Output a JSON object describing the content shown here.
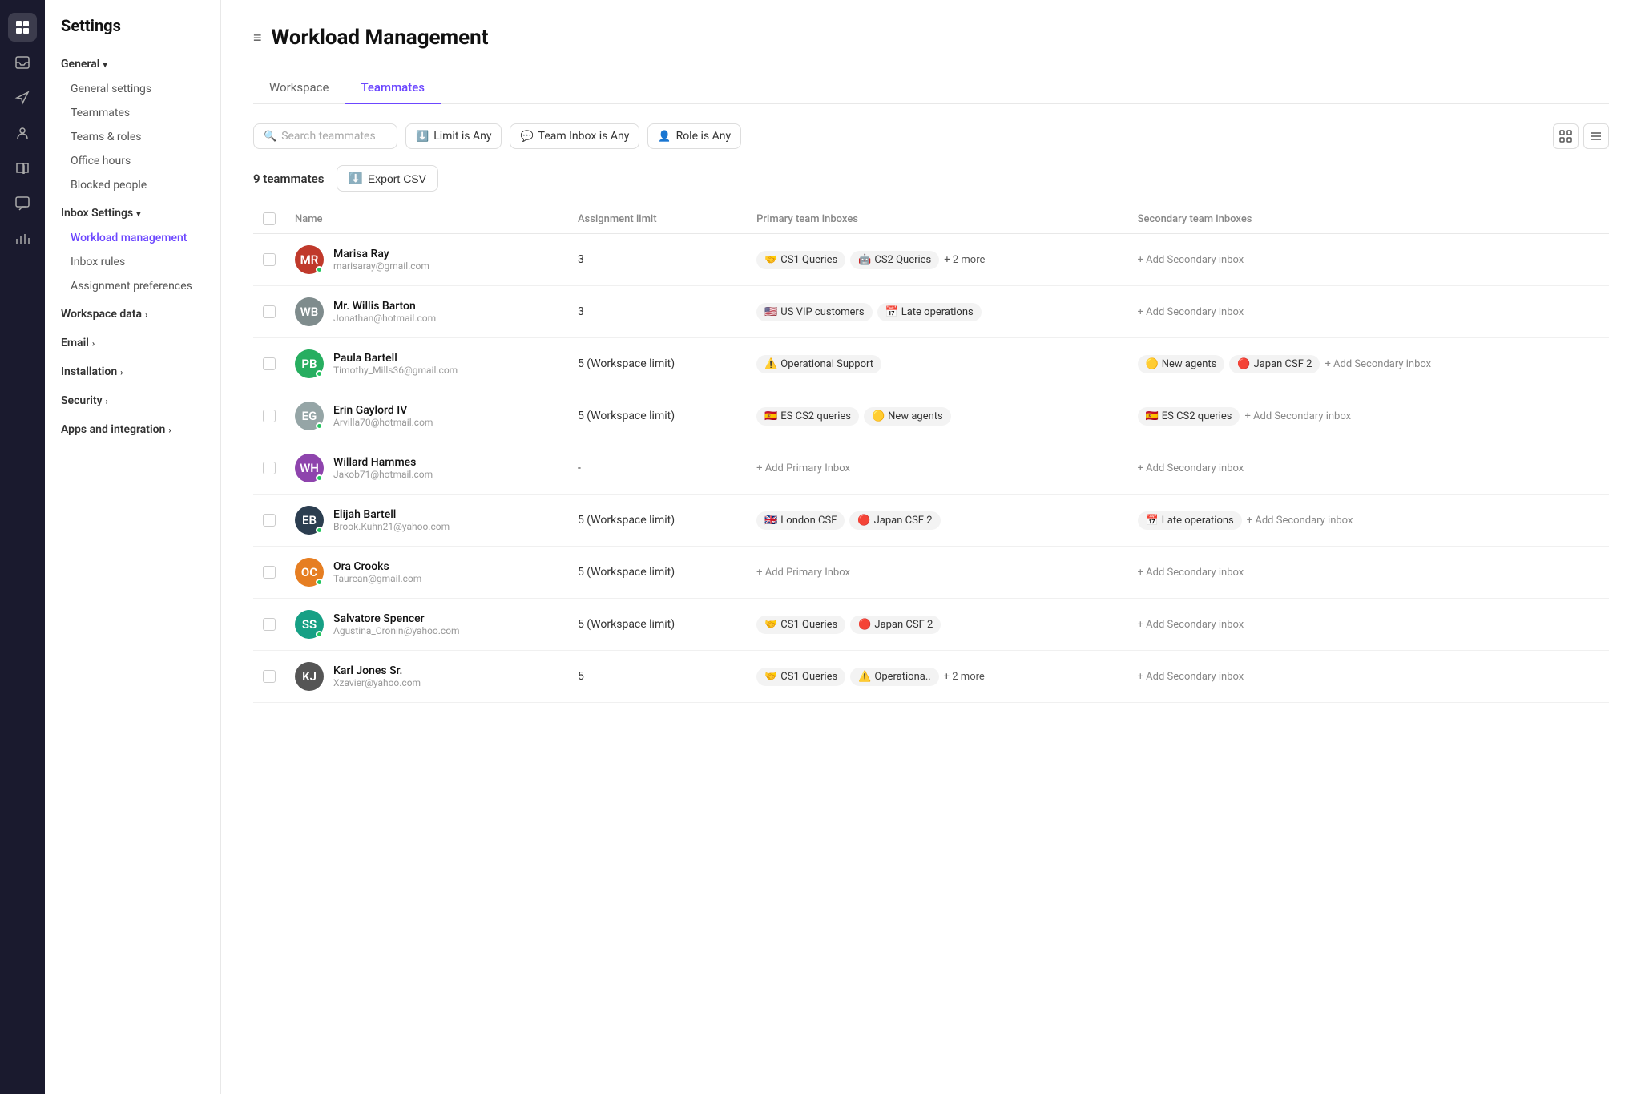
{
  "app": {
    "title": "Settings"
  },
  "sidebar": {
    "title": "Settings",
    "sections": [
      {
        "label": "General",
        "has_chevron": true,
        "items": [
          {
            "label": "General settings",
            "active": false
          },
          {
            "label": "Teammates",
            "active": false
          },
          {
            "label": "Teams & roles",
            "active": false
          },
          {
            "label": "Office hours",
            "active": false
          },
          {
            "label": "Blocked people",
            "active": false
          }
        ]
      },
      {
        "label": "Inbox Settings",
        "has_chevron": true,
        "items": [
          {
            "label": "Workload management",
            "active": true
          },
          {
            "label": "Inbox rules",
            "active": false
          },
          {
            "label": "Assignment preferences",
            "active": false
          }
        ]
      },
      {
        "label": "Workspace data",
        "has_chevron": true,
        "items": []
      },
      {
        "label": "Email",
        "has_chevron": true,
        "items": []
      },
      {
        "label": "Installation",
        "has_chevron": true,
        "items": []
      },
      {
        "label": "Security",
        "has_chevron": true,
        "items": []
      },
      {
        "label": "Apps and integration",
        "has_chevron": true,
        "items": []
      }
    ]
  },
  "page": {
    "title": "Workload Management",
    "tabs": [
      {
        "label": "Workspace",
        "active": false
      },
      {
        "label": "Teammates",
        "active": true
      }
    ]
  },
  "filters": {
    "search_placeholder": "Search teammates",
    "limit_label": "Limit is Any",
    "team_inbox_label": "Team Inbox is Any",
    "role_label": "Role is Any"
  },
  "table": {
    "teammates_count": "9 teammates",
    "export_label": "Export CSV",
    "columns": [
      "Name",
      "Assignment limit",
      "Primary team inboxes",
      "Secondary team inboxes"
    ],
    "rows": [
      {
        "name": "Marisa Ray",
        "email": "marisaray@gmail.com",
        "initials": "MR",
        "bg": "#c0392b",
        "online": true,
        "limit": "3",
        "primary_inboxes": [
          {
            "emoji": "🤝",
            "label": "CS1 Queries"
          },
          {
            "emoji": "🤖",
            "label": "CS2 Queries"
          },
          {
            "extra": "+ 2 more"
          }
        ],
        "secondary_inboxes": []
      },
      {
        "name": "Mr. Willis Barton",
        "email": "Jonathan@hotmail.com",
        "initials": "WB",
        "bg": "#7f8c8d",
        "online": false,
        "limit": "3",
        "primary_inboxes": [
          {
            "emoji": "🇺🇸",
            "label": "US VIP customers"
          },
          {
            "emoji": "📅",
            "label": "Late operations"
          }
        ],
        "secondary_inboxes": []
      },
      {
        "name": "Paula Bartell",
        "email": "Timothy_Mills36@gmail.com",
        "initials": "PB",
        "bg": "#27ae60",
        "online": true,
        "limit": "5 (Workspace limit)",
        "primary_inboxes": [
          {
            "emoji": "⚠️",
            "label": "Operational Support"
          }
        ],
        "secondary_inboxes": [
          {
            "emoji": "🟡",
            "label": "New agents"
          },
          {
            "emoji": "🔴",
            "label": "Japan CSF 2"
          }
        ]
      },
      {
        "name": "Erin Gaylord IV",
        "email": "Arvilla70@hotmail.com",
        "initials": "EG",
        "bg": "#95a5a6",
        "online": true,
        "limit": "5 (Workspace limit)",
        "primary_inboxes": [
          {
            "emoji": "🇪🇸",
            "label": "ES CS2 queries"
          },
          {
            "emoji": "🟡",
            "label": "New agents"
          }
        ],
        "secondary_inboxes": [
          {
            "emoji": "🇪🇸",
            "label": "ES CS2 queries"
          }
        ]
      },
      {
        "name": "Willard Hammes",
        "email": "Jakob71@hotmail.com",
        "initials": "WH",
        "bg": "#8e44ad",
        "online": true,
        "limit": "-",
        "primary_inboxes": [],
        "secondary_inboxes": [],
        "add_primary": true,
        "add_secondary": true
      },
      {
        "name": "Elijah Bartell",
        "email": "Brook.Kuhn21@yahoo.com",
        "initials": "EB",
        "bg": "#2c3e50",
        "online": true,
        "limit": "5 (Workspace limit)",
        "primary_inboxes": [
          {
            "emoji": "🇬🇧",
            "label": "London CSF"
          },
          {
            "emoji": "🔴",
            "label": "Japan CSF 2"
          }
        ],
        "secondary_inboxes": [
          {
            "emoji": "📅",
            "label": "Late operations"
          }
        ]
      },
      {
        "name": "Ora Crooks",
        "email": "Taurean@gmail.com",
        "initials": "OC",
        "bg": "#e67e22",
        "online": true,
        "limit": "5 (Workspace limit)",
        "primary_inboxes": [],
        "secondary_inboxes": [],
        "add_primary": true,
        "add_secondary": true
      },
      {
        "name": "Salvatore Spencer",
        "email": "Agustina_Cronin@yahoo.com",
        "initials": "SS",
        "bg": "#16a085",
        "online": true,
        "limit": "5 (Workspace limit)",
        "primary_inboxes": [
          {
            "emoji": "🤝",
            "label": "CS1 Queries"
          },
          {
            "emoji": "🔴",
            "label": "Japan CSF 2"
          }
        ],
        "secondary_inboxes": []
      },
      {
        "name": "Karl Jones Sr.",
        "email": "Xzavier@yahoo.com",
        "initials": "KJ",
        "bg": "#555",
        "online": false,
        "limit": "5",
        "primary_inboxes": [
          {
            "emoji": "🤝",
            "label": "CS1 Queries"
          },
          {
            "emoji": "⚠️",
            "label": "Operationa.."
          },
          {
            "extra": "+ 2 more"
          }
        ],
        "secondary_inboxes": []
      }
    ]
  },
  "icons": {
    "hamburger": "≡",
    "search": "🔍",
    "limit_icon": "⬇",
    "team_inbox_icon": "💬",
    "role_icon": "👤",
    "export_icon": "⬇",
    "grid_view": "⊞",
    "list_view": "☰",
    "add_primary": "+ Add Primary Inbox",
    "add_secondary": "+ Add Secondary inbox"
  }
}
